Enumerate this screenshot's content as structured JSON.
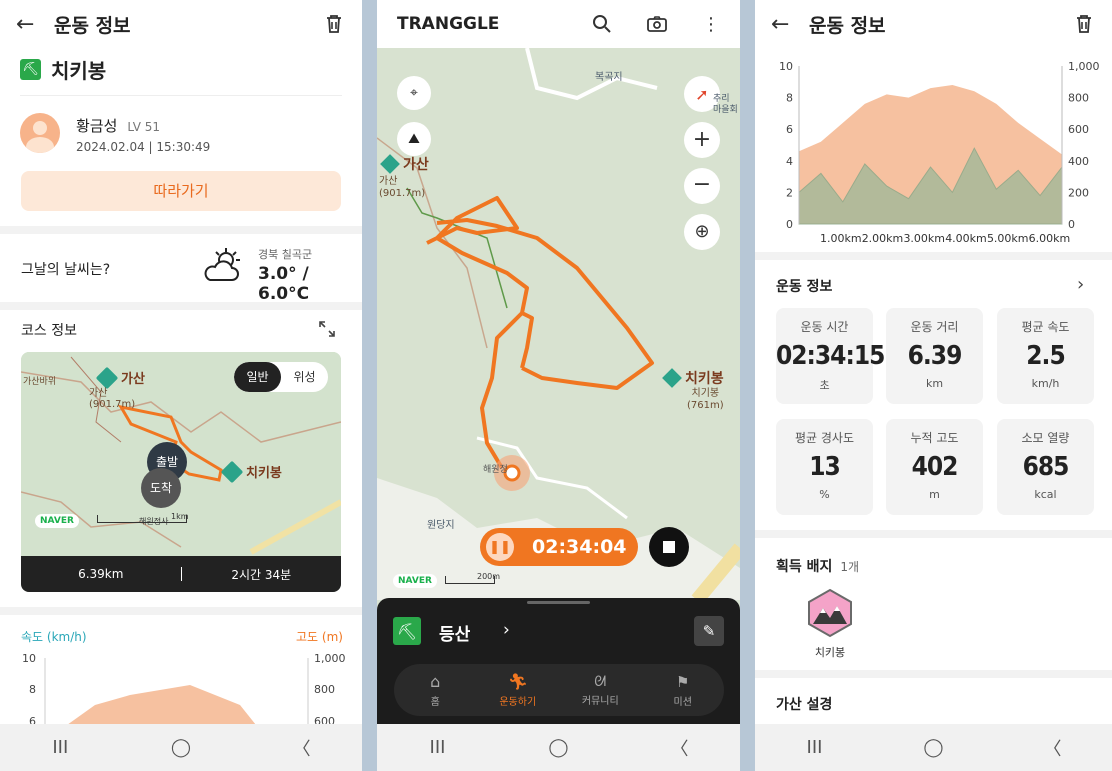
{
  "left": {
    "header": {
      "title": "운동 정보"
    },
    "activity": {
      "name": "치키봉"
    },
    "user": {
      "name": "황금성",
      "level": "LV 51",
      "datetime": "2024.02.04 | 15:30:49"
    },
    "follow_button": "따라가기",
    "weather": {
      "question": "그날의 날씨는?",
      "location": "경북 칠곡군",
      "temp": "3.0° / 6.0°C"
    },
    "course": {
      "title": "코스 정보",
      "map_toggle": [
        "일반",
        "위성"
      ],
      "start": "출발",
      "end": "도착",
      "peak_a": "가산",
      "peak_a_sub": "가산\n(901.7m)",
      "peak_b": "치키봉",
      "naver": "NAVER",
      "scale": "1km",
      "distance": "6.39km",
      "duration": "2시간 34분",
      "map_small": [
        "가산바위",
        "해원정사"
      ]
    },
    "chart_legend": {
      "speed": "속도 (km/h)",
      "alt": "고도 (m)"
    },
    "chart_ticks": {
      "left": [
        "10",
        "8",
        "6"
      ],
      "right": [
        "1,000",
        "800",
        "600"
      ]
    }
  },
  "middle": {
    "brand": "TRANGGLE",
    "timer": "02:34:04",
    "map": {
      "peak_a": "가산",
      "peak_a_sub": "가산\n(901.7m)",
      "peak_b": "치키봉",
      "peak_b_sub": "치기봉\n(761m)",
      "places": [
        "복곡지",
        "추리\n마을회",
        "해원정",
        "원당지"
      ],
      "naver": "NAVER",
      "scale": "200m"
    },
    "sheet": {
      "activity": "등산"
    },
    "tabs": [
      {
        "label": "홈",
        "icon": "home-icon"
      },
      {
        "label": "운동하기",
        "icon": "run-icon"
      },
      {
        "label": "커뮤니티",
        "icon": "community-icon"
      },
      {
        "label": "미션",
        "icon": "flag-icon"
      }
    ]
  },
  "right": {
    "header": {
      "title": "운동 정보"
    },
    "section_title": "운동 정보",
    "stats": [
      {
        "title": "운동 시간",
        "value": "02:34:15",
        "unit": "초"
      },
      {
        "title": "운동 거리",
        "value": "6.39",
        "unit": "km"
      },
      {
        "title": "평균 속도",
        "value": "2.5",
        "unit": "km/h"
      },
      {
        "title": "평균 경사도",
        "value": "13",
        "unit": "%"
      },
      {
        "title": "누적 고도",
        "value": "402",
        "unit": "m"
      },
      {
        "title": "소모 열량",
        "value": "685",
        "unit": "kcal"
      }
    ],
    "badges": {
      "title": "획득 배지",
      "count": "1개",
      "badge_name": "치키봉"
    },
    "bottom_title": "가산 설경"
  },
  "chart_data": {
    "type": "area",
    "x": [
      "1.00km",
      "2.00km",
      "3.00km",
      "4.00km",
      "5.00km",
      "6.00km"
    ],
    "y_left_ticks": [
      0,
      2,
      4,
      6,
      8,
      10
    ],
    "y_right_ticks": [
      "0",
      "200",
      "400",
      "600",
      "800",
      "1,000"
    ],
    "ylim_left": [
      0,
      10
    ],
    "ylim_right": [
      0,
      1000
    ],
    "series": [
      {
        "name": "고도 (m)",
        "axis": "right",
        "values": [
          460,
          520,
          640,
          760,
          820,
          800,
          860,
          880,
          840,
          760,
          640,
          540,
          440
        ]
      },
      {
        "name": "속도 (km/h)",
        "axis": "left",
        "values": [
          2.0,
          3.2,
          1.4,
          3.8,
          2.4,
          1.6,
          3.6,
          2.0,
          4.8,
          2.2,
          3.4,
          1.8,
          3.6
        ]
      }
    ],
    "colors": {
      "altitude": "#f6c1a0",
      "speed": "#8aa888",
      "speed_fill": "#a7b99a"
    }
  }
}
